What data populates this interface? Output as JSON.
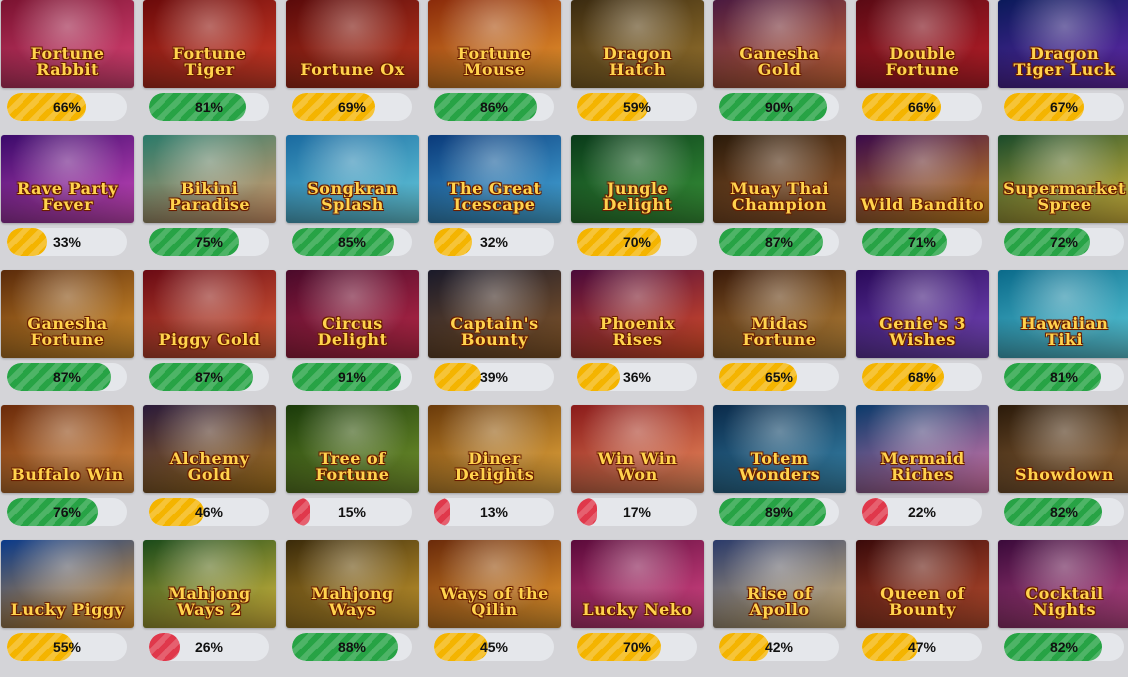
{
  "games": [
    {
      "title": "Fortune Rabbit",
      "rtp": 66,
      "tier": "yellow",
      "colors": [
        "#7a1230",
        "#e0467a"
      ]
    },
    {
      "title": "Fortune Tiger",
      "rtp": 81,
      "tier": "green",
      "colors": [
        "#6b0a0a",
        "#d8402a"
      ]
    },
    {
      "title": "Fortune Ox",
      "rtp": 69,
      "tier": "yellow",
      "colors": [
        "#5a0a0a",
        "#c33a1f"
      ]
    },
    {
      "title": "Fortune Mouse",
      "rtp": 86,
      "tier": "green",
      "colors": [
        "#8a2a0a",
        "#f0a030"
      ]
    },
    {
      "title": "Dragon Hatch",
      "rtp": 59,
      "tier": "yellow",
      "colors": [
        "#3a2a10",
        "#a07a30"
      ]
    },
    {
      "title": "Ganesha Gold",
      "rtp": 90,
      "tier": "green",
      "colors": [
        "#4a1a40",
        "#d06a3a"
      ]
    },
    {
      "title": "Double Fortune",
      "rtp": 66,
      "tier": "yellow",
      "colors": [
        "#5a0a14",
        "#c0202a"
      ]
    },
    {
      "title": "Dragon Tiger Luck",
      "rtp": 67,
      "tier": "yellow",
      "colors": [
        "#0a1a5a",
        "#6a2ab0"
      ]
    },
    {
      "title": "Rave Party Fever",
      "rtp": 33,
      "tier": "yellow",
      "colors": [
        "#3a0a6a",
        "#d04ac0"
      ]
    },
    {
      "title": "Bikini Paradise",
      "rtp": 75,
      "tier": "green",
      "colors": [
        "#2a7a6a",
        "#e0a070"
      ]
    },
    {
      "title": "Songkran Splash",
      "rtp": 85,
      "tier": "green",
      "colors": [
        "#1a6aa0",
        "#6ad0e0"
      ]
    },
    {
      "title": "The Great Icescape",
      "rtp": 32,
      "tier": "yellow",
      "colors": [
        "#0a3a7a",
        "#4ab0e0"
      ]
    },
    {
      "title": "Jungle Delight",
      "rtp": 70,
      "tier": "yellow",
      "colors": [
        "#0a3a1a",
        "#3a9a3a"
      ]
    },
    {
      "title": "Muay Thai Champion",
      "rtp": 87,
      "tier": "green",
      "colors": [
        "#2a1a0a",
        "#a06030"
      ]
    },
    {
      "title": "Wild Bandito",
      "rtp": 71,
      "tier": "green",
      "colors": [
        "#3a0a4a",
        "#d08a20"
      ]
    },
    {
      "title": "Supermarket Spree",
      "rtp": 72,
      "tier": "green",
      "colors": [
        "#1a4a2a",
        "#e0c040"
      ]
    },
    {
      "title": "Ganesha Fortune",
      "rtp": 87,
      "tier": "green",
      "colors": [
        "#5a2a0a",
        "#e09a30"
      ]
    },
    {
      "title": "Piggy Gold",
      "rtp": 87,
      "tier": "green",
      "colors": [
        "#6a0a14",
        "#e0603a"
      ]
    },
    {
      "title": "Circus Delight",
      "rtp": 91,
      "tier": "green",
      "colors": [
        "#4a0a2a",
        "#c02a4a"
      ]
    },
    {
      "title": "Captain's Bounty",
      "rtp": 39,
      "tier": "yellow",
      "colors": [
        "#1a1a2a",
        "#8a5a2a"
      ]
    },
    {
      "title": "Phoenix Rises",
      "rtp": 36,
      "tier": "yellow",
      "colors": [
        "#4a0a3a",
        "#e0502a"
      ]
    },
    {
      "title": "Midas Fortune",
      "rtp": 65,
      "tier": "yellow",
      "colors": [
        "#3a1a0a",
        "#c08a3a"
      ]
    },
    {
      "title": "Genie's 3 Wishes",
      "rtp": 68,
      "tier": "yellow",
      "colors": [
        "#2a0a5a",
        "#7a4ac0"
      ]
    },
    {
      "title": "Hawaiian Tiki",
      "rtp": 81,
      "tier": "green",
      "colors": [
        "#0a6a8a",
        "#60d0e0"
      ]
    },
    {
      "title": "Buffalo Win",
      "rtp": 76,
      "tier": "green",
      "colors": [
        "#6a2a0a",
        "#e09040"
      ]
    },
    {
      "title": "Alchemy Gold",
      "rtp": 46,
      "tier": "yellow",
      "colors": [
        "#2a1a3a",
        "#b07a20"
      ]
    },
    {
      "title": "Tree of Fortune",
      "rtp": 15,
      "tier": "red",
      "colors": [
        "#1a3a0a",
        "#7a9a30"
      ]
    },
    {
      "title": "Diner Delights",
      "rtp": 13,
      "tier": "red",
      "colors": [
        "#6a3a0a",
        "#f0b040"
      ]
    },
    {
      "title": "Win Win Won",
      "rtp": 17,
      "tier": "red",
      "colors": [
        "#8a1a1a",
        "#f09060"
      ]
    },
    {
      "title": "Totem Wonders",
      "rtp": 89,
      "tier": "green",
      "colors": [
        "#0a2a4a",
        "#3a8ab0"
      ]
    },
    {
      "title": "Mermaid Riches",
      "rtp": 22,
      "tier": "red",
      "colors": [
        "#0a3a6a",
        "#e07ab0"
      ]
    },
    {
      "title": "Showdown",
      "rtp": 82,
      "tier": "green",
      "colors": [
        "#2a1a0a",
        "#a07040"
      ]
    },
    {
      "title": "Lucky Piggy",
      "rtp": 55,
      "tier": "yellow",
      "colors": [
        "#0a3a8a",
        "#f0a030"
      ]
    },
    {
      "title": "Mahjong Ways 2",
      "rtp": 26,
      "tier": "red",
      "colors": [
        "#1a4a1a",
        "#e0c040"
      ]
    },
    {
      "title": "Mahjong Ways",
      "rtp": 88,
      "tier": "green",
      "colors": [
        "#3a2a0a",
        "#d0a030"
      ]
    },
    {
      "title": "Ways of the Qilin",
      "rtp": 45,
      "tier": "yellow",
      "colors": [
        "#6a2a0a",
        "#f0a030"
      ]
    },
    {
      "title": "Lucky Neko",
      "rtp": 70,
      "tier": "yellow",
      "colors": [
        "#5a0a3a",
        "#e04a8a"
      ]
    },
    {
      "title": "Rise of Apollo",
      "rtp": 42,
      "tier": "yellow",
      "colors": [
        "#2a3a6a",
        "#e0c080"
      ]
    },
    {
      "title": "Queen of Bounty",
      "rtp": 47,
      "tier": "yellow",
      "colors": [
        "#3a0a0a",
        "#c05030"
      ]
    },
    {
      "title": "Cocktail Nights",
      "rtp": 82,
      "tier": "green",
      "colors": [
        "#3a0a3a",
        "#c04a8a"
      ]
    }
  ]
}
